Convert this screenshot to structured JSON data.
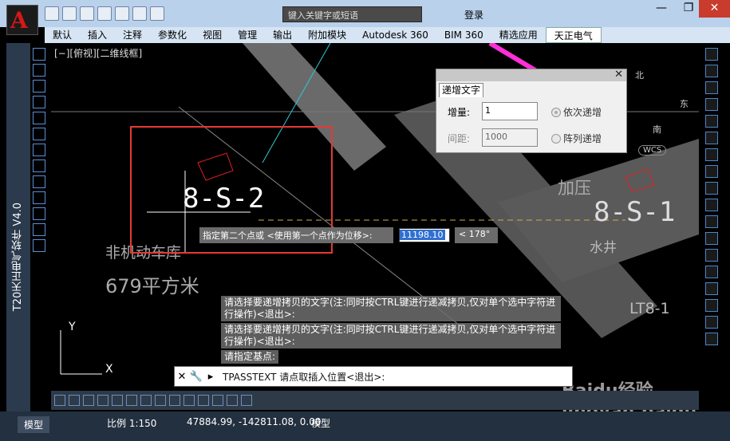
{
  "app": {
    "icon_letter": "A",
    "side_label": "T20天正电气软件 V4.0"
  },
  "search": {
    "placeholder": "键入关键字或短语"
  },
  "titlebar": {
    "signin_label": "登录"
  },
  "menu": {
    "tabs": [
      "默认",
      "插入",
      "注释",
      "参数化",
      "视图",
      "管理",
      "输出",
      "附加模块",
      "Autodesk 360",
      "BIM 360",
      "精选应用",
      "天正电气"
    ],
    "active": "天正电气"
  },
  "viewport": {
    "label": "[−][俯视][二维线框]"
  },
  "dialog": {
    "title": "递增文字",
    "increment_label": "增量:",
    "increment_value": "1",
    "spacing_label": "间距:",
    "spacing_value": "1000",
    "opt_sequential": "依次递增",
    "opt_array": "阵列递增"
  },
  "prompt": {
    "text": "指定第二个点或 <使用第一个点作为位移>:",
    "coordinate": "11198.10",
    "angle": "< 178°"
  },
  "drawing_text": {
    "mark_main": "8-S-2",
    "mark_right": "8-S-1",
    "room": "非机动车库",
    "area": "679平方米",
    "pressure": "加压",
    "well": "水井",
    "code": "LT8-1"
  },
  "command_history": [
    "请选择要递增拷贝的文字(注:同时按CTRL键进行递减拷贝,仅对单个选中字符进行操作)<退出>:",
    "请选择要递增拷贝的文字(注:同时按CTRL键进行递减拷贝,仅对单个选中字符进行操作)<退出>:",
    "请指定基点:"
  ],
  "command_line": {
    "text": "TPASSTEXT 请点取插入位置<退出>:"
  },
  "status": {
    "model_tab": "模型",
    "scale": "比例 1:150",
    "coords": "47884.99, -142811.08, 0.00",
    "space": "模型"
  },
  "axes": {
    "x": "X",
    "y": "Y"
  },
  "viewcube": {
    "north": "北",
    "east": "东",
    "south": "南",
    "wcs": "WCS"
  },
  "watermark": "Baidu经验 jingyan.baidu.com"
}
